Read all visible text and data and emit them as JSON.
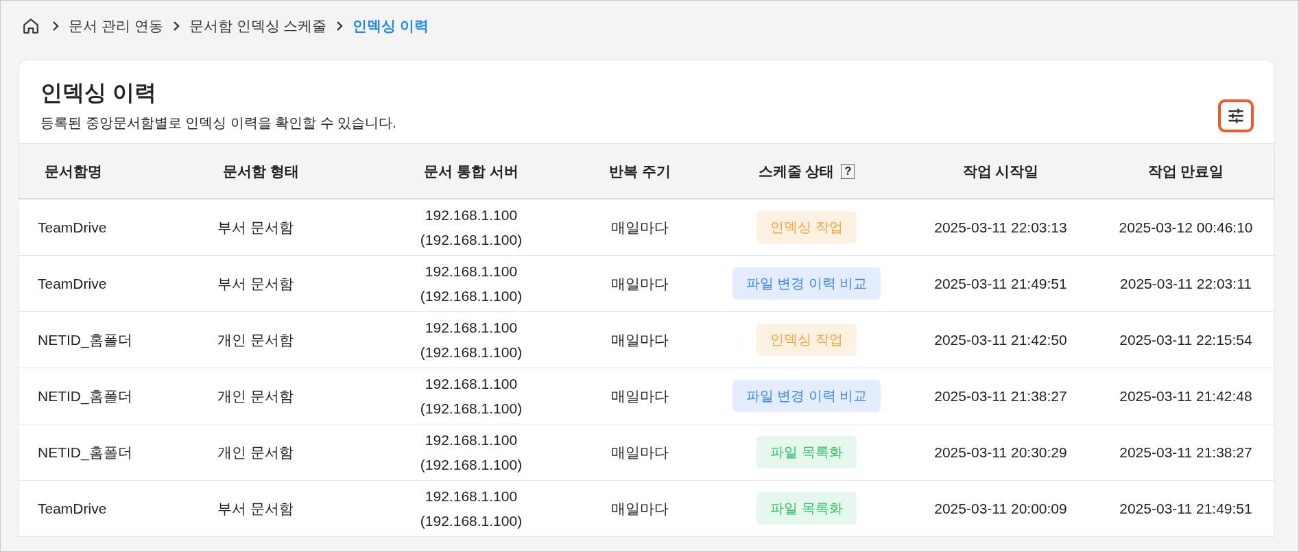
{
  "breadcrumb": [
    {
      "label": "문서 관리 연동",
      "current": false
    },
    {
      "label": "문서함 인덱싱 스케줄",
      "current": false
    },
    {
      "label": "인덱싱 이력",
      "current": true
    }
  ],
  "page": {
    "title": "인덱싱 이력",
    "description": "등록된 중앙문서함별로 인덱싱 이력을 확인할 수 있습니다."
  },
  "table": {
    "columns": [
      {
        "label": "문서함명"
      },
      {
        "label": "문서함 형태"
      },
      {
        "label": "문서 통합 서버"
      },
      {
        "label": "반복 주기"
      },
      {
        "label": "스케줄 상태",
        "help": "?"
      },
      {
        "label": "작업 시작일"
      },
      {
        "label": "작업 만료일"
      }
    ],
    "rows": [
      {
        "name": "TeamDrive",
        "type": "부서 문서함",
        "server": "192.168.1.100",
        "server_sub": "(192.168.1.100)",
        "cycle": "매일마다",
        "status": {
          "label": "인덱싱 작업",
          "kind": "indexing"
        },
        "start": "2025-03-11 22:03:13",
        "end": "2025-03-12 00:46:10"
      },
      {
        "name": "TeamDrive",
        "type": "부서 문서함",
        "server": "192.168.1.100",
        "server_sub": "(192.168.1.100)",
        "cycle": "매일마다",
        "status": {
          "label": "파일 변경 이력 비교",
          "kind": "compare"
        },
        "start": "2025-03-11 21:49:51",
        "end": "2025-03-11 22:03:11"
      },
      {
        "name": "NETID_홈폴더",
        "type": "개인 문서함",
        "server": "192.168.1.100",
        "server_sub": "(192.168.1.100)",
        "cycle": "매일마다",
        "status": {
          "label": "인덱싱 작업",
          "kind": "indexing"
        },
        "start": "2025-03-11 21:42:50",
        "end": "2025-03-11 22:15:54"
      },
      {
        "name": "NETID_홈폴더",
        "type": "개인 문서함",
        "server": "192.168.1.100",
        "server_sub": "(192.168.1.100)",
        "cycle": "매일마다",
        "status": {
          "label": "파일 변경 이력 비교",
          "kind": "compare"
        },
        "start": "2025-03-11 21:38:27",
        "end": "2025-03-11 21:42:48"
      },
      {
        "name": "NETID_홈폴더",
        "type": "개인 문서함",
        "server": "192.168.1.100",
        "server_sub": "(192.168.1.100)",
        "cycle": "매일마다",
        "status": {
          "label": "파일 목록화",
          "kind": "listing"
        },
        "start": "2025-03-11 20:30:29",
        "end": "2025-03-11 21:38:27"
      },
      {
        "name": "TeamDrive",
        "type": "부서 문서함",
        "server": "192.168.1.100",
        "server_sub": "(192.168.1.100)",
        "cycle": "매일마다",
        "status": {
          "label": "파일 목록화",
          "kind": "listing"
        },
        "start": "2025-03-11 20:00:09",
        "end": "2025-03-11 21:49:51"
      }
    ]
  }
}
